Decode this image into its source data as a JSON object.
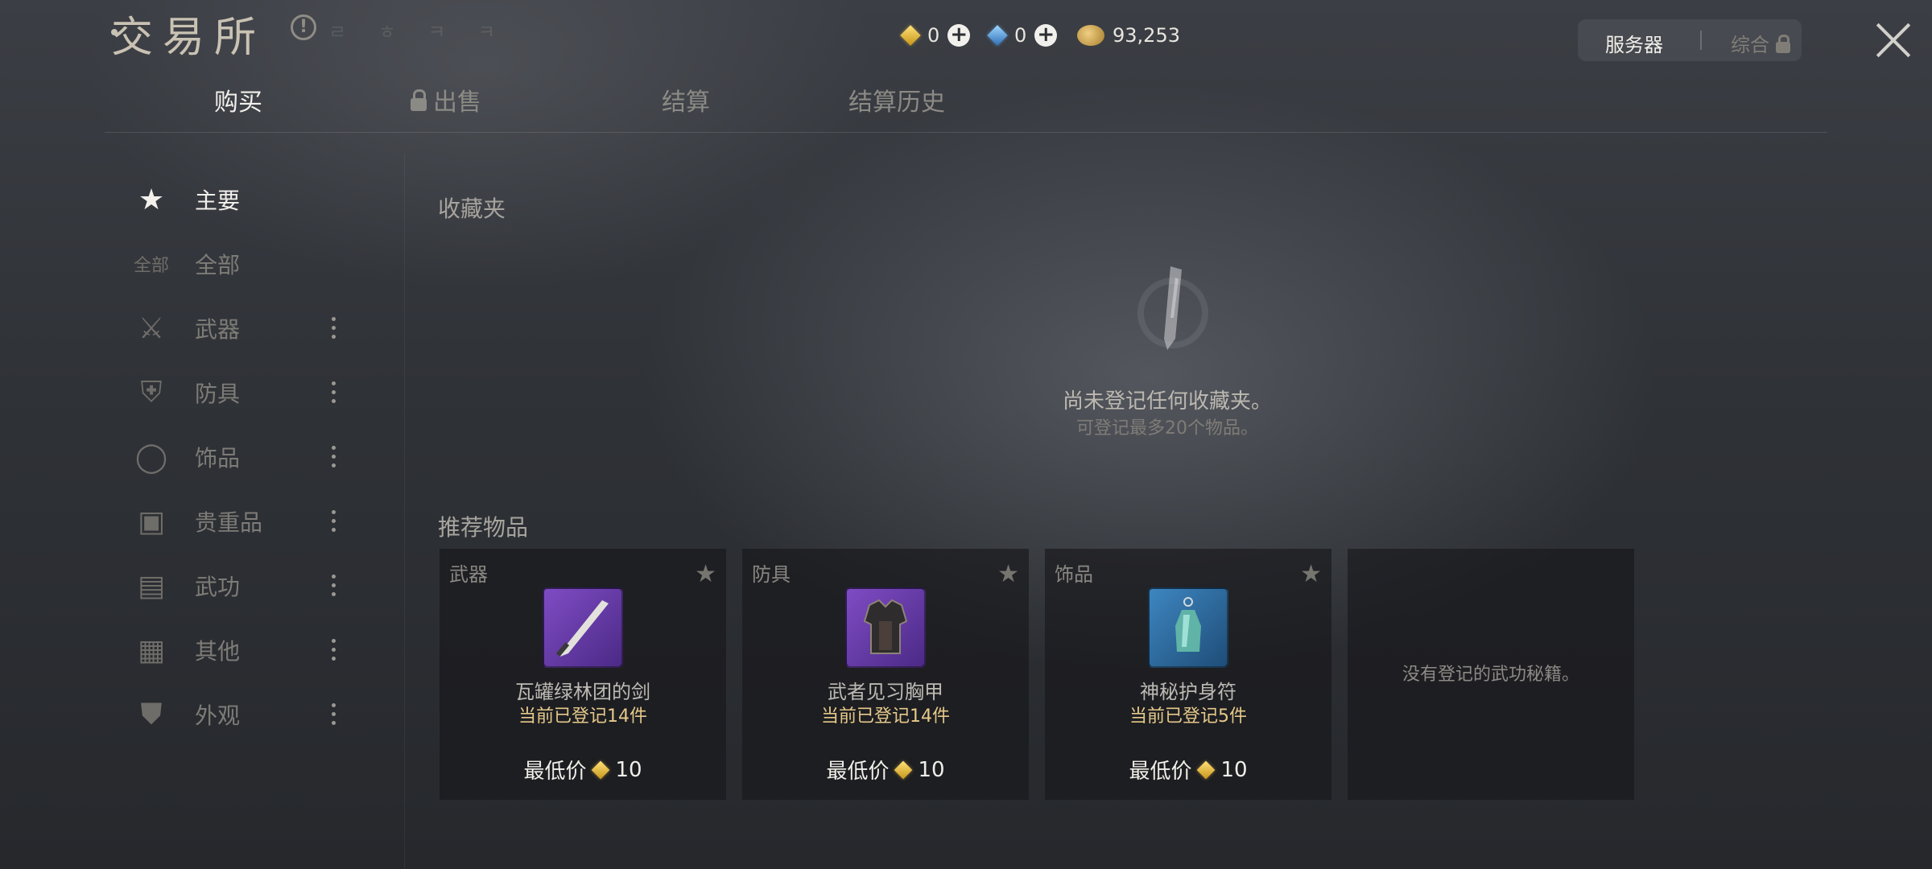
{
  "header": {
    "title": "交易所",
    "title_faded": "ㄹ ㅎ ㅋ ㅋ",
    "currencies": [
      {
        "icon": "yellow-gem-icon",
        "value": "0"
      },
      {
        "icon": "blue-gem-icon",
        "value": "0"
      },
      {
        "icon": "gold-coin-icon",
        "value": "93,253"
      }
    ],
    "server_label": "服务器",
    "general_label": "综合"
  },
  "tabs": [
    {
      "label": "购买",
      "active": true,
      "locked": false
    },
    {
      "label": "出售",
      "active": false,
      "locked": true
    },
    {
      "label": "结算",
      "active": false,
      "locked": false
    },
    {
      "label": "结算历史",
      "active": false,
      "locked": false
    }
  ],
  "sidebar": {
    "items": [
      {
        "label": "主要",
        "icon": "star-icon",
        "active": true
      },
      {
        "label": "全部",
        "tag": "全部"
      },
      {
        "label": "武器",
        "icon": "sword-icon"
      },
      {
        "label": "防具",
        "icon": "armor-icon"
      },
      {
        "label": "饰品",
        "icon": "ring-icon"
      },
      {
        "label": "贵重品",
        "icon": "chest-icon"
      },
      {
        "label": "武功",
        "icon": "book-icon"
      },
      {
        "label": "其他",
        "icon": "box-icon"
      },
      {
        "label": "外观",
        "icon": "robe-icon"
      }
    ]
  },
  "main": {
    "favorites_title": "收藏夹",
    "favorites_empty_main": "尚未登记任何收藏夹。",
    "favorites_empty_sub": "可登记最多20个物品。",
    "recommended_title": "推荐物品",
    "cards": [
      {
        "category": "武器",
        "name": "瓦罐绿林团的剑",
        "count": "当前已登记14件",
        "price_label": "最低价",
        "price": "10",
        "thumb": "sword-item-icon",
        "thumb_color": "#6a3fa8"
      },
      {
        "category": "防具",
        "name": "武者见习胸甲",
        "count": "当前已登记14件",
        "price_label": "最低价",
        "price": "10",
        "thumb": "chest-armor-item-icon",
        "thumb_color": "#6a3fa8"
      },
      {
        "category": "饰品",
        "name": "神秘护身符",
        "count": "当前已登记5件",
        "price_label": "最低价",
        "price": "10",
        "thumb": "amulet-item-icon",
        "thumb_color": "#2f6fa0"
      }
    ],
    "empty_card_text": "没有登记的武功秘籍。"
  }
}
